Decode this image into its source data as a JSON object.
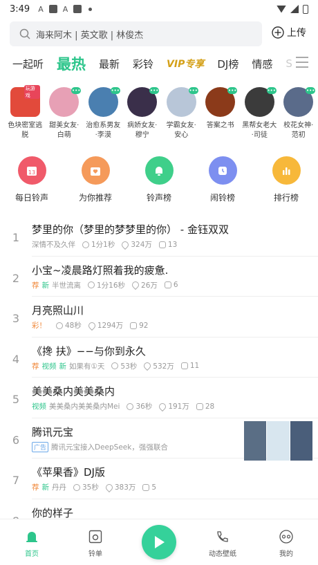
{
  "status_bar": {
    "time": "3:49"
  },
  "search": {
    "placeholder": "海来阿木 | 英文歌 | 林俊杰"
  },
  "upload_label": "上传",
  "tabs": [
    "一起听",
    "最热",
    "最新",
    "彩铃",
    "VIP专享",
    "DJ榜",
    "情感",
    "S"
  ],
  "avatars": [
    {
      "label": "色块密室逃脱",
      "tag": "玩游戏",
      "color": "#e24a3b"
    },
    {
      "label": "甜美女友·白萌",
      "color": "#e7a0b5"
    },
    {
      "label": "治愈系男友·李漠",
      "color": "#4a7fb0"
    },
    {
      "label": "病娇女友·穆宁",
      "color": "#3a2f4a"
    },
    {
      "label": "学霸女友·安心",
      "color": "#b8c6d8"
    },
    {
      "label": "答案之书",
      "color": "#8b3a1a"
    },
    {
      "label": "黑帮女老大·司徒",
      "color": "#3b3b3b"
    },
    {
      "label": "校花女神·范初",
      "color": "#5a6b8a"
    }
  ],
  "quick_actions": [
    {
      "label": "每日铃声",
      "color": "#f05a6a",
      "icon": "calendar-icon"
    },
    {
      "label": "为你推荐",
      "color": "#f59a5a",
      "icon": "heart-bag-icon"
    },
    {
      "label": "铃声榜",
      "color": "#3fcf8a",
      "icon": "bell-icon"
    },
    {
      "label": "闹铃榜",
      "color": "#7d8ff0",
      "icon": "alarm-icon"
    },
    {
      "label": "排行榜",
      "color": "#f7b83a",
      "icon": "bar-chart-icon"
    }
  ],
  "songs": [
    {
      "rank": "1",
      "title": "梦里的你（梦里的梦梦里的你） - 金钰双双",
      "tags": [],
      "artist": "深情不及久伴",
      "duration": "1分1秒",
      "heat": "324万",
      "comments": "13"
    },
    {
      "rank": "2",
      "title": "小宝~凌晨路灯照着我的疲惫.",
      "tags": [
        {
          "t": "荐",
          "c": "orange"
        },
        {
          "t": "新",
          "c": "green"
        }
      ],
      "artist": "半世流离",
      "duration": "1分16秒",
      "heat": "26万",
      "comments": "6"
    },
    {
      "rank": "3",
      "title": "月亮照山川",
      "tags": [
        {
          "t": "彩！",
          "c": "orange"
        }
      ],
      "artist": "",
      "duration": "48秒",
      "heat": "1294万",
      "comments": "92"
    },
    {
      "rank": "4",
      "title": "《搀 扶》−−与你到永久",
      "tags": [
        {
          "t": "荐",
          "c": "orange"
        },
        {
          "t": "视频",
          "c": "green"
        },
        {
          "t": "新",
          "c": "green"
        }
      ],
      "artist": "如果有①天",
      "duration": "53秒",
      "heat": "532万",
      "comments": "11"
    },
    {
      "rank": "5",
      "title": "美美桑内美美桑内",
      "tags": [
        {
          "t": "视频",
          "c": "green"
        }
      ],
      "artist": "美美桑内美美桑内Mei",
      "duration": "36秒",
      "heat": "191万",
      "comments": "28"
    },
    {
      "rank": "6",
      "title": "腾讯元宝",
      "tags": [
        {
          "t": "广告",
          "c": "ad"
        }
      ],
      "artist": "腾讯元宝接入DeepSeek，强强联合",
      "duration": "",
      "heat": "",
      "comments": ""
    },
    {
      "rank": "7",
      "title": "《苹果香》DJ版",
      "tags": [
        {
          "t": "荐",
          "c": "orange"
        },
        {
          "t": "新",
          "c": "green"
        }
      ],
      "artist": "丹丹",
      "duration": "35秒",
      "heat": "383万",
      "comments": "5"
    },
    {
      "rank": "8",
      "title": "你的样子",
      "tags": [],
      "artist": "",
      "duration": "",
      "heat": "",
      "comments": ""
    }
  ],
  "bottom_nav": [
    {
      "label": "首页",
      "icon": "home-bell-icon",
      "active": true
    },
    {
      "label": "铃单",
      "icon": "playlist-icon"
    },
    {
      "label": "",
      "icon": "play-icon"
    },
    {
      "label": "动态壁纸",
      "icon": "phone-video-icon"
    },
    {
      "label": "我的",
      "icon": "profile-icon"
    }
  ]
}
